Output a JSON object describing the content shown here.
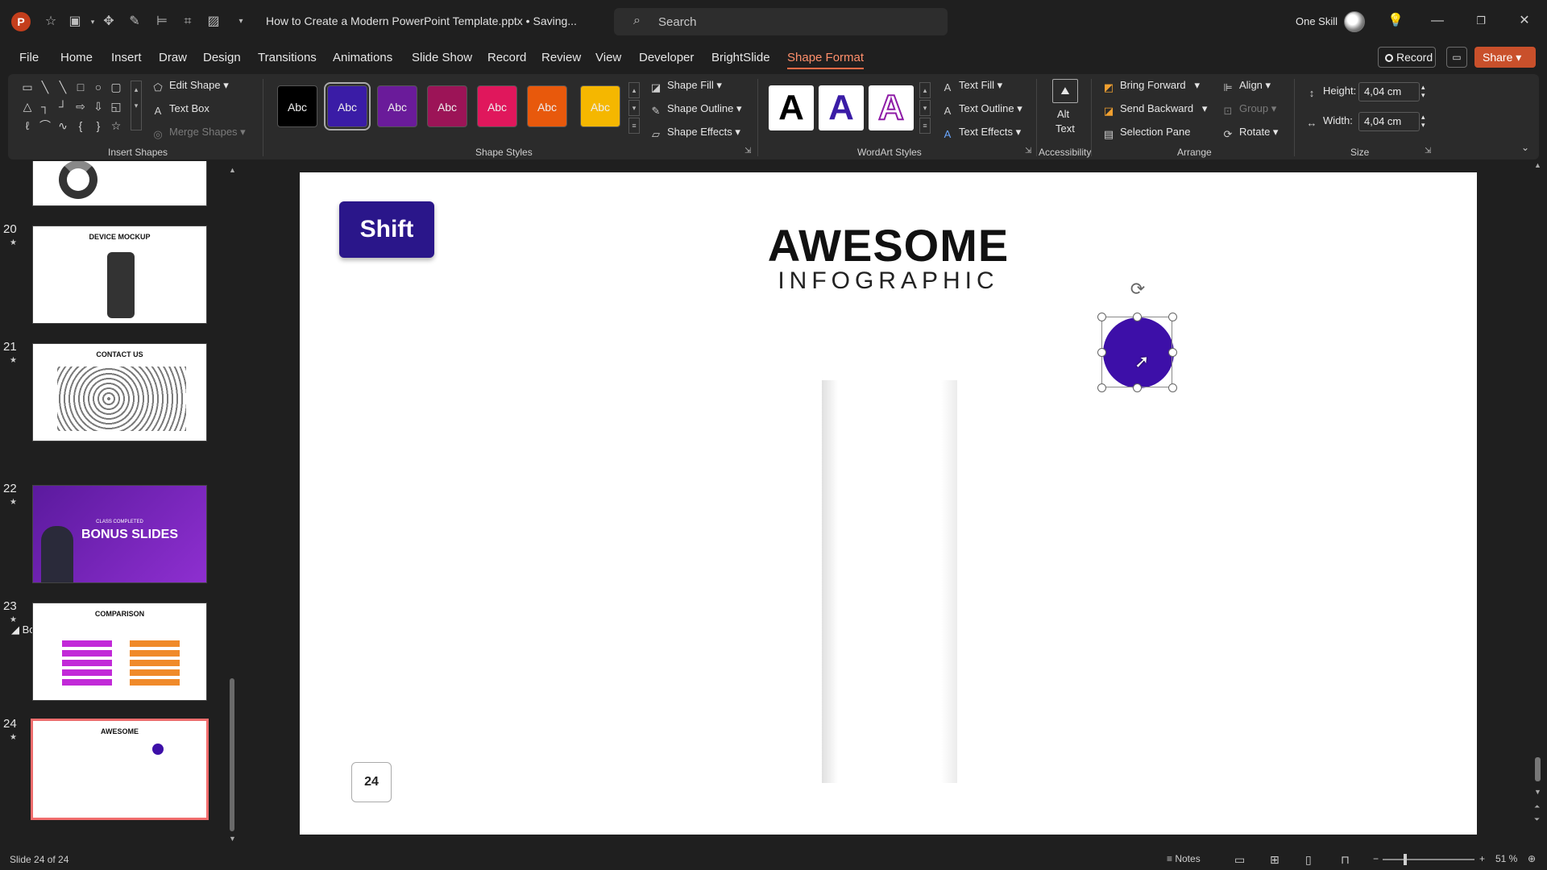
{
  "titlebar": {
    "app_logo": "P",
    "doc_title": "How to Create a Modern PowerPoint Template.pptx • Saving...",
    "search_placeholder": "Search",
    "user_name": "One Skill"
  },
  "tabs": [
    {
      "label": "File"
    },
    {
      "label": "Home"
    },
    {
      "label": "Insert"
    },
    {
      "label": "Draw"
    },
    {
      "label": "Design"
    },
    {
      "label": "Transitions"
    },
    {
      "label": "Animations"
    },
    {
      "label": "Slide Show"
    },
    {
      "label": "Record"
    },
    {
      "label": "Review"
    },
    {
      "label": "View"
    },
    {
      "label": "Developer"
    },
    {
      "label": "BrightSlide"
    },
    {
      "label": "Shape Format"
    }
  ],
  "top_buttons": {
    "record": "Record",
    "share": "Share"
  },
  "ribbon": {
    "insert_shapes": {
      "label": "Insert Shapes",
      "edit_shape": "Edit Shape",
      "text_box": "Text Box",
      "merge_shapes": "Merge Shapes"
    },
    "shape_styles": {
      "label": "Shape Styles",
      "swatch_text": "Abc",
      "swatch_colors": [
        "#000000",
        "#3a1ca6",
        "#6a1b9a",
        "#9c1457",
        "#e0175c",
        "#e8590c",
        "#f5b700"
      ],
      "shape_fill": "Shape Fill",
      "shape_outline": "Shape Outline",
      "shape_effects": "Shape Effects"
    },
    "wordart_styles": {
      "label": "WordArt Styles",
      "letter": "A",
      "text_fill": "Text Fill",
      "text_outline": "Text Outline",
      "text_effects": "Text Effects"
    },
    "accessibility": {
      "label": "Accessibility",
      "alt_text_1": "Alt",
      "alt_text_2": "Text"
    },
    "arrange": {
      "label": "Arrange",
      "bring_forward": "Bring Forward",
      "send_backward": "Send Backward",
      "selection_pane": "Selection Pane",
      "align": "Align",
      "group": "Group",
      "rotate": "Rotate"
    },
    "size": {
      "label": "Size",
      "height_label": "Height:",
      "height_value": "4,04 cm",
      "width_label": "Width:",
      "width_value": "4,04 cm"
    }
  },
  "thumbnails": {
    "section_label": "Bonus Slides",
    "slides": [
      {
        "num": "20",
        "title": "DEVICE MOCKUP"
      },
      {
        "num": "21",
        "title": "CONTACT US"
      },
      {
        "num": "22",
        "title": "BONUS SLIDES",
        "pre": "CLASS COMPLETED"
      },
      {
        "num": "23",
        "title": "COMPARISON"
      },
      {
        "num": "24",
        "title": "AWESOME"
      }
    ]
  },
  "slide": {
    "badge": "Shift",
    "title": "AWESOME",
    "subtitle": "INFOGRAPHIC",
    "page_number": "24",
    "circle_color": "#3d0fa8"
  },
  "statusbar": {
    "slide_count": "Slide 24 of 24",
    "notes": "Notes",
    "zoom": "51 %"
  }
}
